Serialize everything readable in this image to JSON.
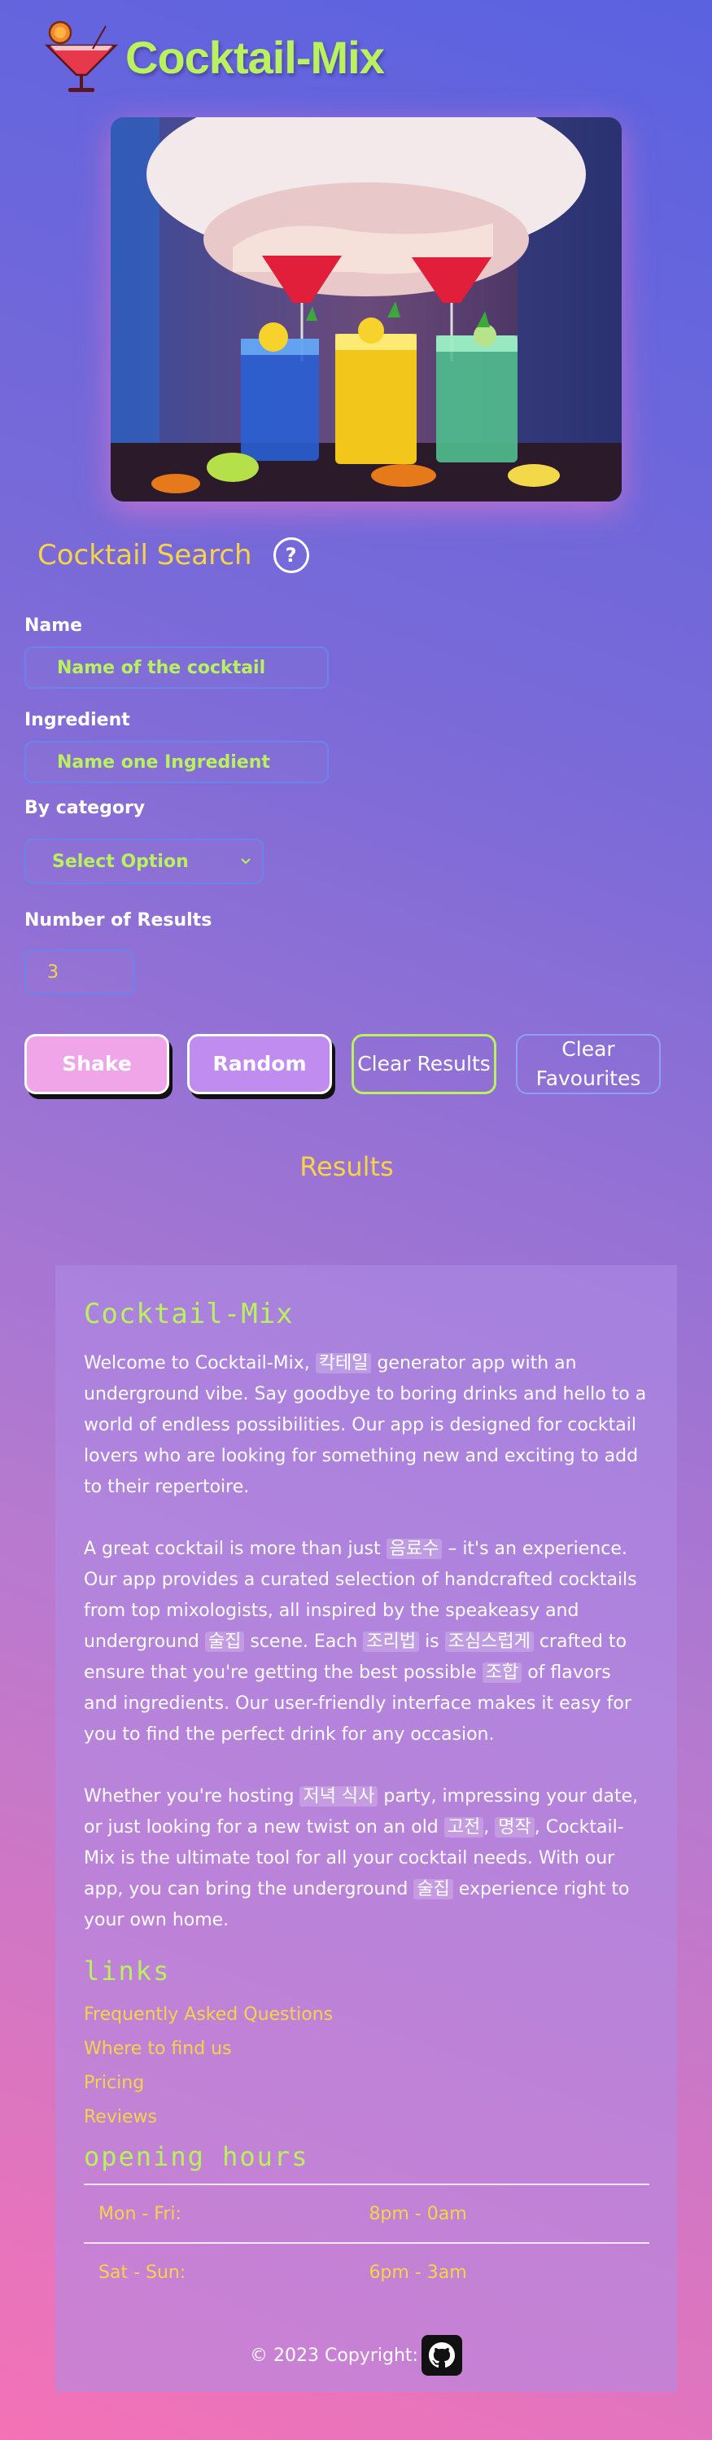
{
  "header": {
    "title": "Cocktail-Mix",
    "logo_icon": "cocktail-glass-icon"
  },
  "search": {
    "title": "Cocktail Search",
    "help_glyph": "?",
    "name_label": "Name",
    "name_placeholder": "Name of the cocktail",
    "ingredient_label": "Ingredient",
    "ingredient_placeholder": "Name one Ingredient",
    "category_label": "By category",
    "category_value": "Select Option",
    "number_label": "Number of Results",
    "number_value": "3"
  },
  "buttons": {
    "shake": "Shake",
    "random": "Random",
    "clear_results": "Clear Results",
    "clear_favourites_line1": "Clear",
    "clear_favourites_line2": "Favourites"
  },
  "results": {
    "title": "Results"
  },
  "about": {
    "title": "Cocktail-Mix",
    "p1": [
      "Welcome to Cocktail-Mix, ",
      "칵테일",
      " generator app with an underground vibe. Say goodbye to boring drinks and hello to a world of endless possibilities. Our app is designed for cocktail lovers who are looking for something new and exciting to add to their repertoire."
    ],
    "p2": [
      "A great cocktail is more than just ",
      "음료수",
      " – it's an experience. Our app provides a curated selection of handcrafted cocktails from top mixologists, all inspired by the speakeasy and underground ",
      "술집",
      " scene. Each ",
      "조리법",
      " is ",
      "조심스럽게",
      " crafted to ensure that you're getting the best possible ",
      "조합",
      " of flavors and ingredients. Our user-friendly interface makes it easy for you to find the perfect drink for any occasion."
    ],
    "p3": [
      "Whether you're hosting ",
      "저녁 식사",
      " party, impressing your date, or just looking for a new twist on an old ",
      "고전",
      ", ",
      "명작",
      ", Cocktail-Mix is the ultimate tool for all your cocktail needs. With our app, you can bring the underground ",
      "술집",
      " experience right to your own home."
    ]
  },
  "links": {
    "title": "links",
    "items": [
      "Frequently Asked Questions",
      "Where to find us",
      "Pricing",
      "Reviews"
    ]
  },
  "hours": {
    "title": "opening hours",
    "rows": [
      {
        "days": "Mon - Fri:",
        "time": "8pm - 0am"
      },
      {
        "days": "Sat - Sun:",
        "time": "6pm - 3am"
      }
    ]
  },
  "footer": {
    "copyright": "© 2023 Copyright:",
    "icon": "github-icon"
  },
  "colors": {
    "accent_green": "#b9f25e",
    "accent_yellow": "#f6d447",
    "shake": "#f0a5e8",
    "random": "#c08cf0"
  }
}
